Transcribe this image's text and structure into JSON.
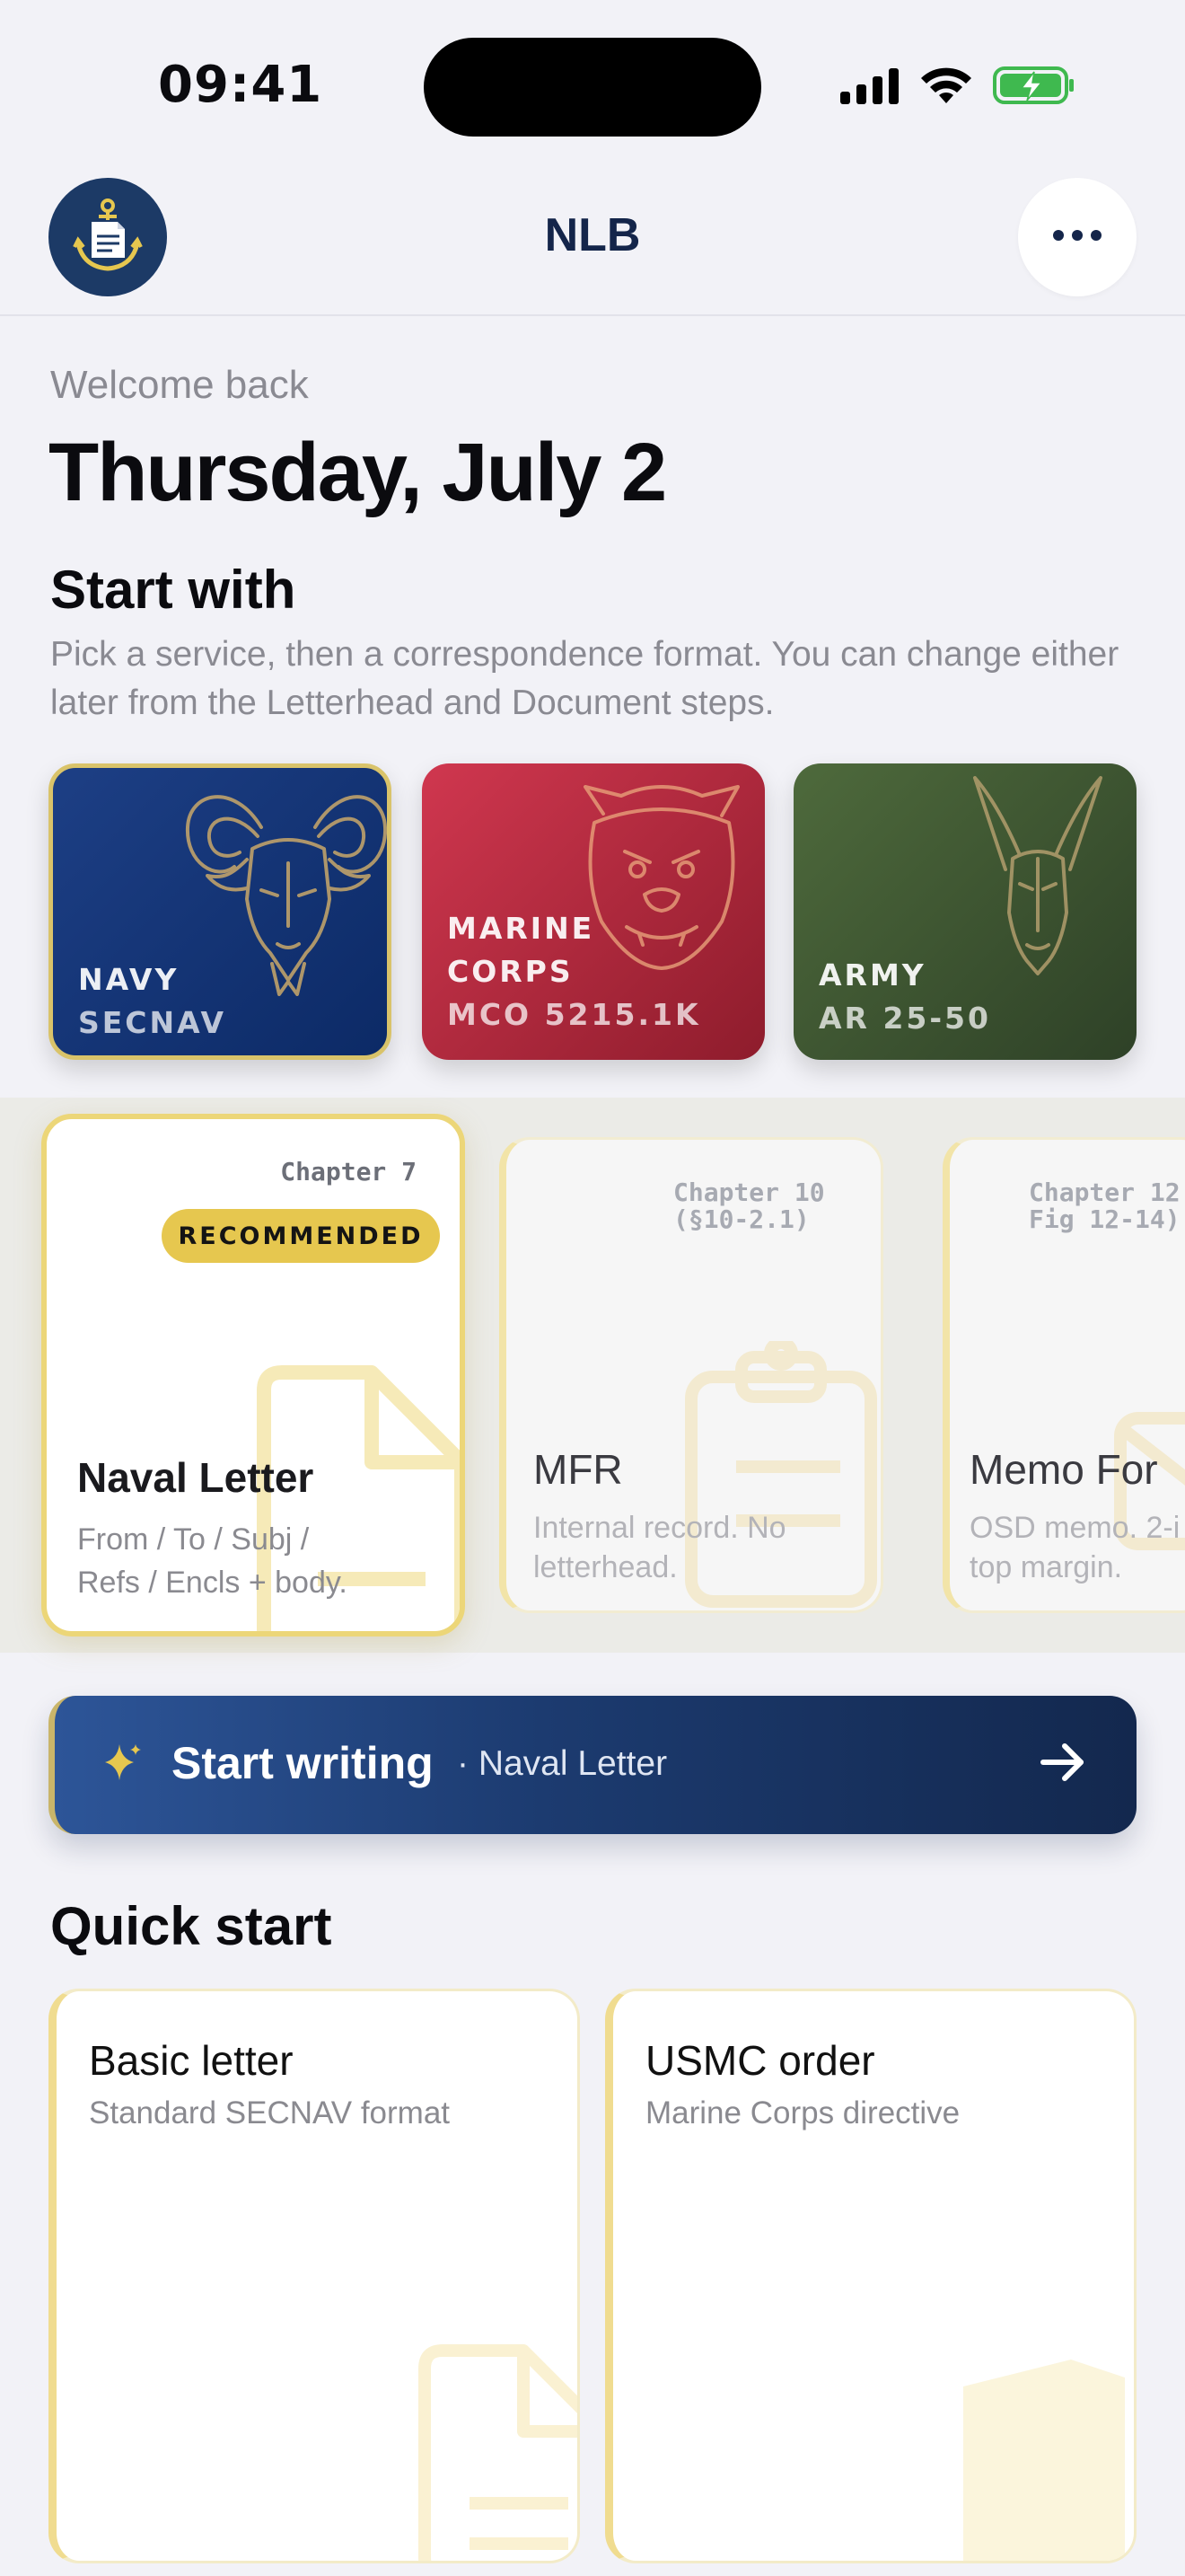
{
  "status_bar": {
    "time": "09:41"
  },
  "header": {
    "title": "NLB"
  },
  "greeting": {
    "welcome": "Welcome back",
    "date": "Thursday, July 2"
  },
  "start_with": {
    "title": "Start with",
    "description": "Pick a service, then a correspondence format. You can change either later from the Letterhead and Document steps."
  },
  "services": [
    {
      "name_line1": "NAVY",
      "name_line2": "",
      "ref": "SECNAV",
      "color_from": "#1d3f85",
      "color_to": "#0c2a66",
      "mascot": "goat-icon",
      "selected": true
    },
    {
      "name_line1": "MARINE",
      "name_line2": "CORPS",
      "ref": "MCO 5215.1K",
      "color_from": "#d0374f",
      "color_to": "#8e1c2c",
      "mascot": "bulldog-icon",
      "selected": false
    },
    {
      "name_line1": "ARMY",
      "name_line2": "",
      "ref": "AR 25-50",
      "color_from": "#4e6a3c",
      "color_to": "#2e4127",
      "mascot": "mule-icon",
      "selected": false
    }
  ],
  "formats": [
    {
      "chapter": "Chapter 7",
      "badge": "RECOMMENDED",
      "title": "Naval Letter",
      "desc_line1": "From / To / Subj /",
      "desc_line2": "Refs / Encls + body.",
      "icon": "document-icon"
    },
    {
      "chapter_line1": "Chapter 10",
      "chapter_line2": "(§10-2.1)",
      "title": "MFR",
      "desc_line1": "Internal record. No",
      "desc_line2": "letterhead.",
      "icon": "clipboard-icon"
    },
    {
      "chapter_line1": "Chapter 12",
      "chapter_line2": "Fig 12-14)",
      "title": "Memo For",
      "desc_line1": "OSD memo. 2-i",
      "desc_line2": "top margin.",
      "icon": "envelope-icon"
    }
  ],
  "cta": {
    "label": "Start writing",
    "sub": "· Naval Letter",
    "accent": "#e6c74f"
  },
  "quick_start": {
    "title": "Quick start",
    "items": [
      {
        "name": "Basic letter",
        "desc": "Standard SECNAV format"
      },
      {
        "name": "USMC order",
        "desc": "Marine Corps directive"
      }
    ]
  },
  "colors": {
    "navy": "#14254a",
    "gold": "#e6c74f",
    "background": "#f2f2f7"
  }
}
